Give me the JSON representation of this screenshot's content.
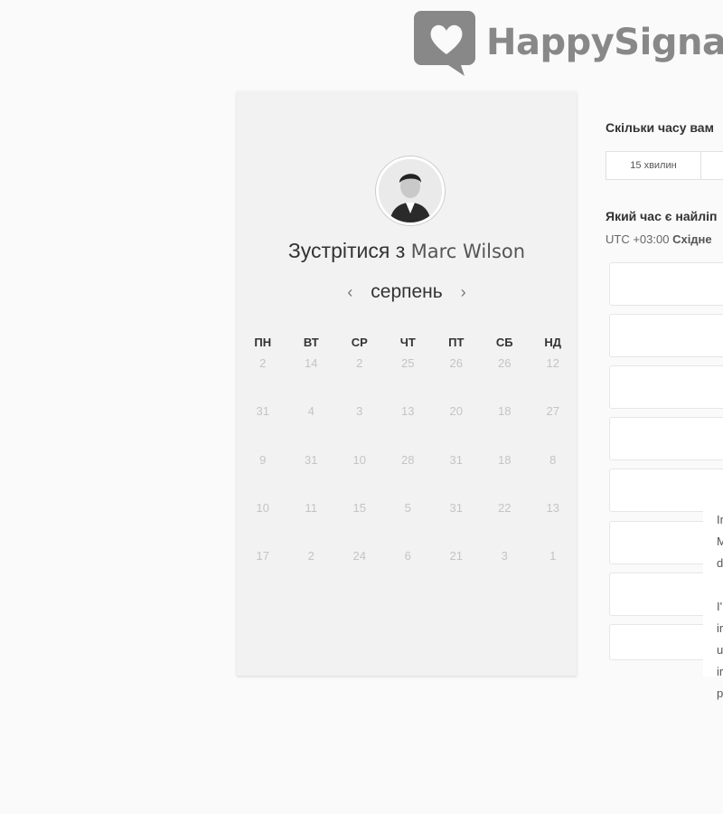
{
  "brand": {
    "name": "HappySignal"
  },
  "scheduler": {
    "avatar_alt": "Marc Wilson avatar",
    "title_prefix": "Зустрітися з",
    "host_name": "Marc Wilson",
    "month": "серпень",
    "prev_icon": "chevron-left-icon",
    "next_icon": "chevron-right-icon",
    "weekdays": [
      "ПН",
      "ВТ",
      "СР",
      "ЧТ",
      "ПТ",
      "СБ",
      "НД"
    ],
    "days": [
      [
        "2",
        "14",
        "2",
        "25",
        "26",
        "26",
        "12"
      ],
      [
        "31",
        "4",
        "3",
        "13",
        "20",
        "18",
        "27"
      ],
      [
        "9",
        "31",
        "10",
        "28",
        "31",
        "18",
        "8"
      ],
      [
        "10",
        "11",
        "15",
        "5",
        "31",
        "22",
        "13"
      ],
      [
        "17",
        "2",
        "24",
        "6",
        "21",
        "3",
        "1"
      ]
    ]
  },
  "booking": {
    "duration_question": "Скільки часу вам",
    "duration_options": [
      "15 хвилин",
      ""
    ],
    "time_question": "Який час є найліп",
    "timezone_offset": "UTC +03:00",
    "timezone_name": "Східне"
  },
  "popup_lines": [
    "In",
    "M",
    "d",
    "",
    "I'",
    "ir",
    "u",
    "ir",
    "p"
  ],
  "colors": {
    "card_bg": "#f2f2f2",
    "logo_gray": "#888888"
  }
}
